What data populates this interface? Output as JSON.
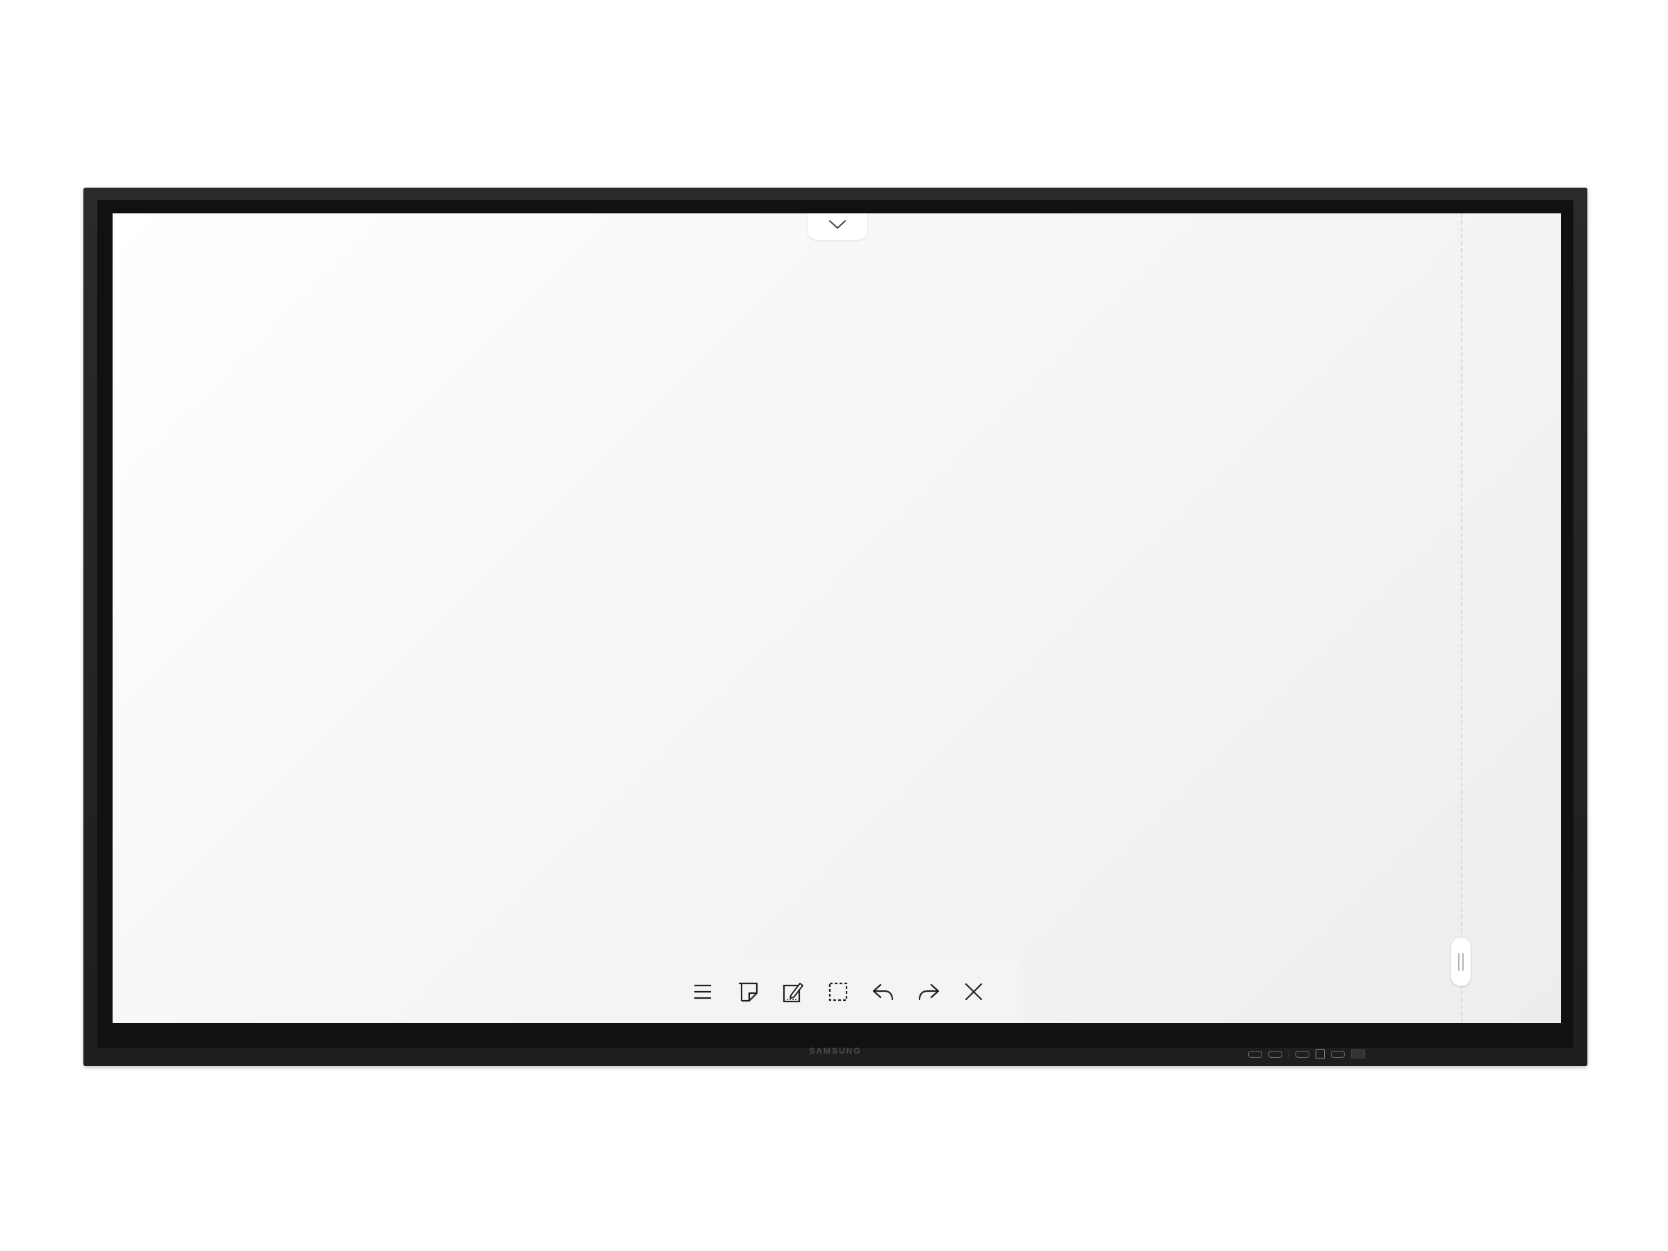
{
  "device": {
    "brand": "SAMSUNG",
    "frame_color": "#1e1e1e"
  },
  "screen": {
    "background_color": "#f6f6f6",
    "top_tab": {
      "icon": "chevron-down-icon"
    },
    "side_handle": {
      "icon": "drag-handle-icon"
    }
  },
  "toolbar": {
    "items": [
      {
        "name": "menu",
        "icon": "menu-icon"
      },
      {
        "name": "sticky-note",
        "icon": "sticky-note-icon"
      },
      {
        "name": "edit-page",
        "icon": "edit-page-icon"
      },
      {
        "name": "select-area",
        "icon": "select-area-icon"
      },
      {
        "name": "undo",
        "icon": "undo-icon"
      },
      {
        "name": "redo",
        "icon": "redo-icon"
      },
      {
        "name": "close",
        "icon": "close-icon"
      }
    ]
  }
}
